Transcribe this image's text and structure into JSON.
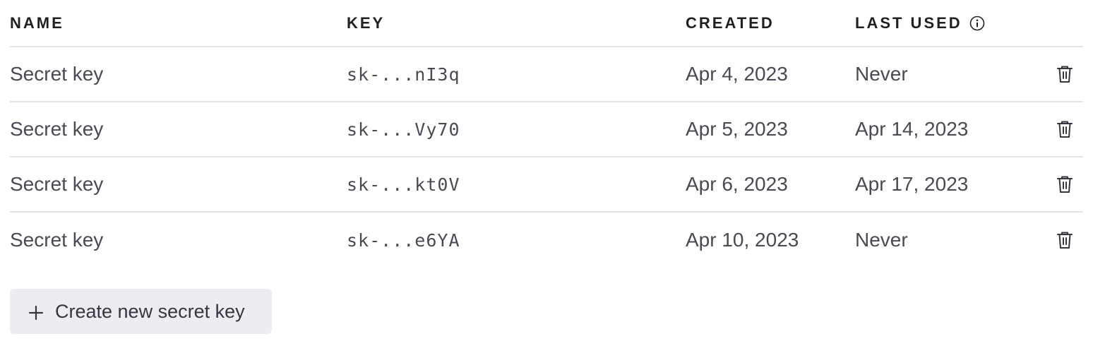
{
  "table": {
    "headers": {
      "name": "NAME",
      "key": "KEY",
      "created": "CREATED",
      "last_used": "LAST USED"
    },
    "rows": [
      {
        "name": "Secret key",
        "key": "sk-...nI3q",
        "created": "Apr 4, 2023",
        "last_used": "Never"
      },
      {
        "name": "Secret key",
        "key": "sk-...Vy70",
        "created": "Apr 5, 2023",
        "last_used": "Apr 14, 2023"
      },
      {
        "name": "Secret key",
        "key": "sk-...kt0V",
        "created": "Apr 6, 2023",
        "last_used": "Apr 17, 2023"
      },
      {
        "name": "Secret key",
        "key": "sk-...e6YA",
        "created": "Apr 10, 2023",
        "last_used": "Never"
      }
    ]
  },
  "actions": {
    "create_label": "Create new secret key"
  },
  "icons": {
    "header_info": "info-icon",
    "row_delete": "trash-icon",
    "create": "plus-icon"
  },
  "colors": {
    "text": "#353740",
    "muted_text": "#4a4a55",
    "divider": "#e5e5e5",
    "button_bg": "#ececf1"
  }
}
